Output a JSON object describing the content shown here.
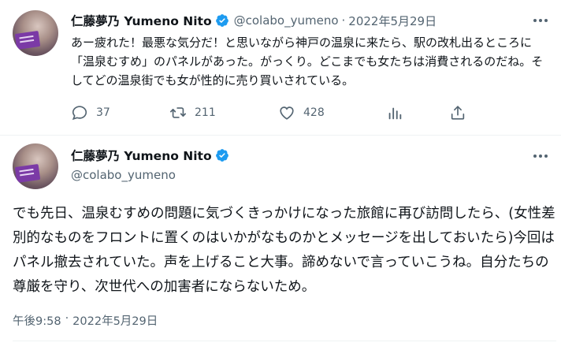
{
  "colors": {
    "verified": "#1d9bf0",
    "secondary_text": "#536471",
    "primary_text": "#0f1419"
  },
  "tweet1": {
    "author_name": "仁藤夢乃 Yumeno Nito",
    "handle": "@colabo_yumeno",
    "separator": "·",
    "date": "2022年5月29日",
    "text": "あー疲れた！最悪な気分だ！と思いながら神戸の温泉に来たら、駅の改札出るところに「温泉むすめ」のパネルがあった。がっくり。どこまでも女たちは消費されるのだね。そしてどの温泉街でも女が性的に売り買いされている。",
    "actions": {
      "reply_count": "37",
      "retweet_count": "211",
      "like_count": "428"
    },
    "icons": [
      "verified-badge-icon",
      "more-icon",
      "reply-icon",
      "retweet-icon",
      "like-icon",
      "analytics-icon",
      "share-icon"
    ]
  },
  "tweet2": {
    "author_name": "仁藤夢乃 Yumeno Nito",
    "handle": "@colabo_yumeno",
    "text": "でも先日、温泉むすめの問題に気づくきっかけになった旅館に再び訪問したら、(女性差別的なものをフロントに置くのはいかがなものかとメッセージを出しておいたら)今回はパネル撤去されていた。声を上げること大事。諦めないで言っていこうね。自分たちの尊厳を守り、次世代への加害者にならないため。",
    "time": "午後9:58",
    "separator": "·",
    "date": "2022年5月29日"
  }
}
